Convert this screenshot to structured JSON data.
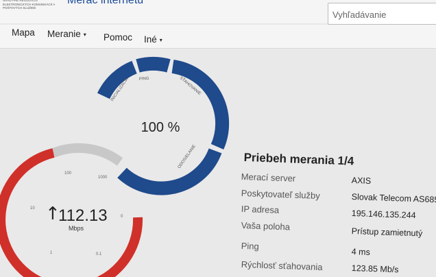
{
  "header": {
    "logo_text": "Úrad pre reguláciu elektronických komunikácií a poštových služieb",
    "app_title": "Merač internetu",
    "search_placeholder": "Vyhľadávanie"
  },
  "nav": {
    "items": [
      {
        "label": "Mapa",
        "dropdown": false
      },
      {
        "label": "Meranie",
        "dropdown": true
      },
      {
        "label": "Pomoc",
        "dropdown": false
      },
      {
        "label": "Iné",
        "dropdown": true
      }
    ],
    "caret": "▾"
  },
  "progress_gauge": {
    "percent_label": "100 %",
    "progress": 1.0,
    "segments": [
      "INICIALIZÁCIA",
      "PING",
      "SŤAHOVANIE",
      "ODOSIELANIE"
    ],
    "color": "#1f4a8c"
  },
  "speed_gauge": {
    "value": "112.13",
    "unit": "Mbps",
    "arrow": "↑",
    "scale_labels": [
      "0",
      "0.1",
      "1",
      "10",
      "100",
      "1000"
    ],
    "color": "#d0302a",
    "track_color": "#c8c8c8"
  },
  "info": {
    "title": "Priebeh merania 1/4",
    "rows": [
      {
        "label": "Merací server",
        "value": "AXIS"
      },
      {
        "label": "Poskytovateľ služby",
        "value": "Slovak Telecom AS685"
      },
      {
        "label": "IP adresa",
        "value": "195.146.135.244"
      },
      {
        "label": "Vaša poloha",
        "value": "Prístup zamietnutý"
      },
      {
        "label": "Ping",
        "value": "4 ms"
      },
      {
        "label": "Rýchlosť sťahovania",
        "value": "123.85 Mb/s"
      }
    ]
  }
}
